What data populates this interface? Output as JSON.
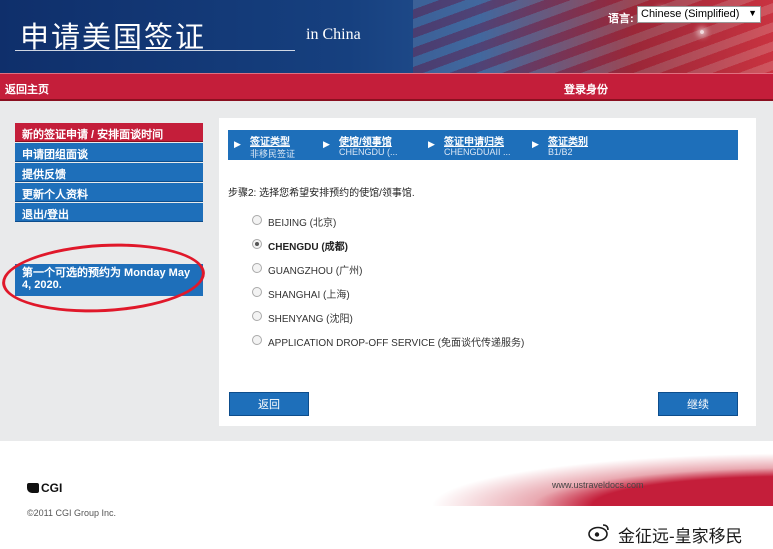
{
  "header": {
    "title_cn": "申请美国签证",
    "title_en": "in China",
    "language_label": "语言:",
    "language_value": "Chinese (Simplified)"
  },
  "navbar": {
    "home": "返回主页",
    "login": "登录身份"
  },
  "sidebar": {
    "items": [
      {
        "label": "新的签证申请 / 安排面谈时间",
        "active": true
      },
      {
        "label": "申请团组面谈",
        "active": false
      },
      {
        "label": "提供反馈",
        "active": false
      },
      {
        "label": "更新个人资料",
        "active": false
      },
      {
        "label": "退出/登出",
        "active": false
      }
    ],
    "appointment_notice": "第一个可选的预约为 Monday May 4, 2020."
  },
  "steps": [
    {
      "label": "签证类型",
      "value": "非移民签证"
    },
    {
      "label": "使馆/领事馆",
      "value": "CHENGDU (..."
    },
    {
      "label": "签证申请归类",
      "value": "CHENGDUAII ..."
    },
    {
      "label": "签证类别",
      "value": "B1/B2"
    }
  ],
  "prompt": "步骤2: 选择您希望安排预约的使馆/领事馆.",
  "options": [
    {
      "label": "BEIJING (北京)",
      "checked": false
    },
    {
      "label": "CHENGDU (成都)",
      "checked": true
    },
    {
      "label": "GUANGZHOU (广州)",
      "checked": false
    },
    {
      "label": "SHANGHAI (上海)",
      "checked": false
    },
    {
      "label": "SHENYANG (沈阳)",
      "checked": false
    },
    {
      "label": "APPLICATION DROP-OFF SERVICE (免面谈代传递服务)",
      "checked": false
    }
  ],
  "buttons": {
    "back": "返回",
    "continue": "继续"
  },
  "footer": {
    "logo_text": "CGI",
    "copyright": "©2011 CGI Group Inc.",
    "site_url": "www.ustraveldocs.com",
    "watermark": "金征远-皇家移民"
  },
  "colors": {
    "nav_red": "#c41e3a",
    "nav_blue": "#1e6fba",
    "header_blue": "#0f2f6b",
    "annotation_red": "#e0182a"
  }
}
